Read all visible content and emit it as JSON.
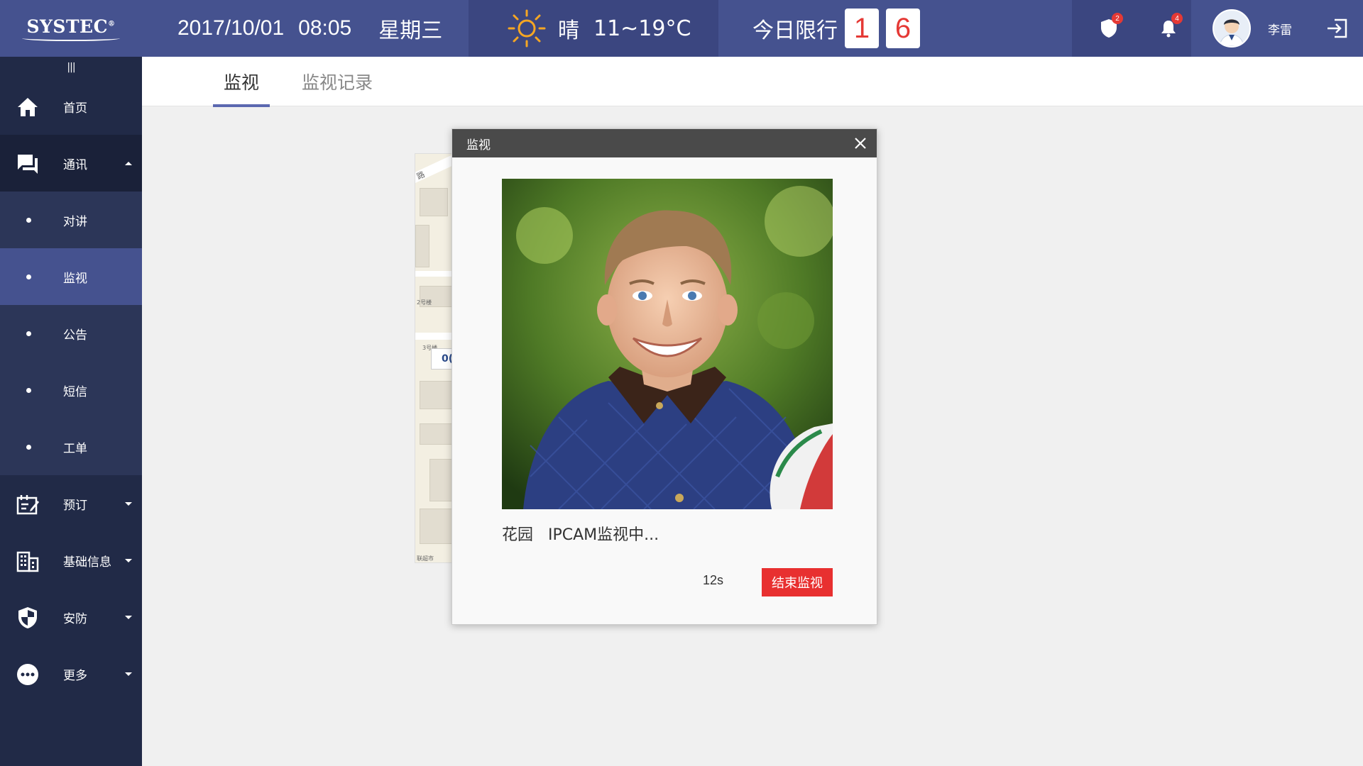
{
  "app": {
    "logo": "SYSTEC",
    "logo_mark": "®"
  },
  "header": {
    "date": "2017/10/01",
    "time": "08:05",
    "weekday": "星期三",
    "weather_icon": "sun-icon",
    "weather_condition": "晴",
    "temperature": "11~19°C",
    "limit_label": "今日限行",
    "limit_numbers": [
      "1",
      "6"
    ],
    "alarm_icon": "shield-icon",
    "alarm_badge": "2",
    "notification_icon": "bell-icon",
    "notification_badge": "4",
    "username": "李雷",
    "logout_icon": "logout-icon"
  },
  "sidebar": {
    "collapse_icon": "|||",
    "items": [
      {
        "label": "首页",
        "icon": "home-icon"
      },
      {
        "label": "通讯",
        "icon": "chat-icon",
        "expanded": true,
        "children": [
          {
            "label": "对讲"
          },
          {
            "label": "监视",
            "active": true
          },
          {
            "label": "公告"
          },
          {
            "label": "短信"
          },
          {
            "label": "工单"
          }
        ]
      },
      {
        "label": "预订",
        "icon": "booking-icon"
      },
      {
        "label": "基础信息",
        "icon": "building-icon"
      },
      {
        "label": "安防",
        "icon": "shield-icon"
      },
      {
        "label": "更多",
        "icon": "more-icon"
      }
    ]
  },
  "tabs": [
    {
      "label": "监视",
      "active": true
    },
    {
      "label": "监视记录",
      "active": false
    }
  ],
  "map": {
    "labels": [
      "路",
      "2号楼",
      "3号楼",
      "联超市"
    ],
    "tag": "0("
  },
  "modal": {
    "title": "监视",
    "close_icon": "close-icon",
    "camera_image": "camera-feed-boy-image",
    "caption": "花园   IPCAM监视中...",
    "countdown": "12s",
    "end_button": "结束监视"
  },
  "colors": {
    "header": "#45528f",
    "header_dark": "#3b4680",
    "sidebar": "#212a47",
    "sidebar_sub": "#2c3658",
    "active": "#45528f",
    "tab_underline": "#5b68b0",
    "danger": "#e83030"
  }
}
